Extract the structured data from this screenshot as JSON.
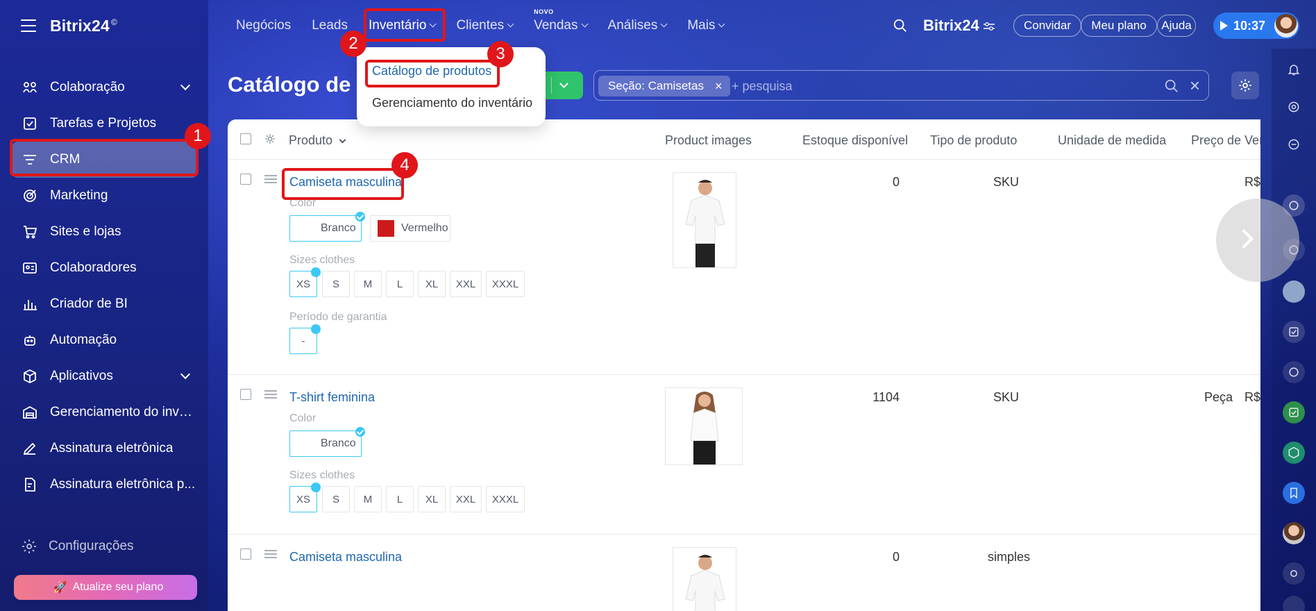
{
  "sidebar": {
    "logo": "Bitrix24",
    "logo_mark": "©",
    "items": [
      {
        "label": "Colaboração"
      },
      {
        "label": "Tarefas e Projetos"
      },
      {
        "label": "CRM"
      },
      {
        "label": "Marketing"
      },
      {
        "label": "Sites e lojas"
      },
      {
        "label": "Colaboradores"
      },
      {
        "label": "Criador de BI"
      },
      {
        "label": "Automação"
      },
      {
        "label": "Aplicativos"
      },
      {
        "label": "Gerenciamento do inve..."
      },
      {
        "label": "Assinatura eletrônica"
      },
      {
        "label": "Assinatura eletrônica p..."
      }
    ],
    "settings_label": "Configurações",
    "upgrade_label": "Atualize seu plano"
  },
  "topnav": {
    "items": [
      {
        "label": "Negócios"
      },
      {
        "label": "Leads"
      },
      {
        "label": "Inventário"
      },
      {
        "label": "Clientes"
      },
      {
        "label": "Vendas",
        "badge": "NOVO"
      },
      {
        "label": "Análises"
      },
      {
        "label": "Mais"
      }
    ],
    "brand": "Bitrix24",
    "invite_label": "Convidar",
    "plan_label": "Meu plano",
    "help_label": "Ajuda",
    "time": "10:37"
  },
  "dropdown": {
    "items": [
      {
        "label": "Catálogo de produtos"
      },
      {
        "label": "Gerenciamento do inventário"
      }
    ]
  },
  "page": {
    "title": "Catálogo de p",
    "filter_chip": "Seção: Camisetas",
    "filter_chip_close": "×",
    "filter_placeholder": "+ pesquisa",
    "filter_close": "×"
  },
  "table": {
    "headers": {
      "product": "Produto",
      "images": "Product images",
      "stock": "Estoque disponível",
      "type": "Tipo de produto",
      "unit": "Unidade de medida",
      "price": "Preço de Ven"
    },
    "rows": [
      {
        "name": "Camiseta masculina",
        "color_label": "Color",
        "colors": [
          "Branco",
          "Vermelho"
        ],
        "sizes_label": "Sizes clothes",
        "sizes": [
          "XS",
          "S",
          "M",
          "L",
          "XL",
          "XXL",
          "XXXL"
        ],
        "warranty_label": "Período de garantia",
        "warranty_value": "-",
        "stock": "0",
        "type": "SKU",
        "unit": "",
        "price": "R$"
      },
      {
        "name": "T-shirt feminina",
        "color_label": "Color",
        "colors": [
          "Branco"
        ],
        "sizes_label": "Sizes clothes",
        "sizes": [
          "XS",
          "S",
          "M",
          "L",
          "XL",
          "XXL",
          "XXXL"
        ],
        "stock": "1104",
        "type": "SKU",
        "unit": "Peça",
        "price": "R$"
      },
      {
        "name": "Camiseta masculina",
        "stock": "0",
        "type": "simples"
      }
    ]
  },
  "annotations": [
    "1",
    "2",
    "3",
    "4"
  ],
  "colors": {
    "highlight": "#e0161a",
    "accent": "#2067b0",
    "selected": "#3bc8f5",
    "add_button": "#2fc36b"
  }
}
